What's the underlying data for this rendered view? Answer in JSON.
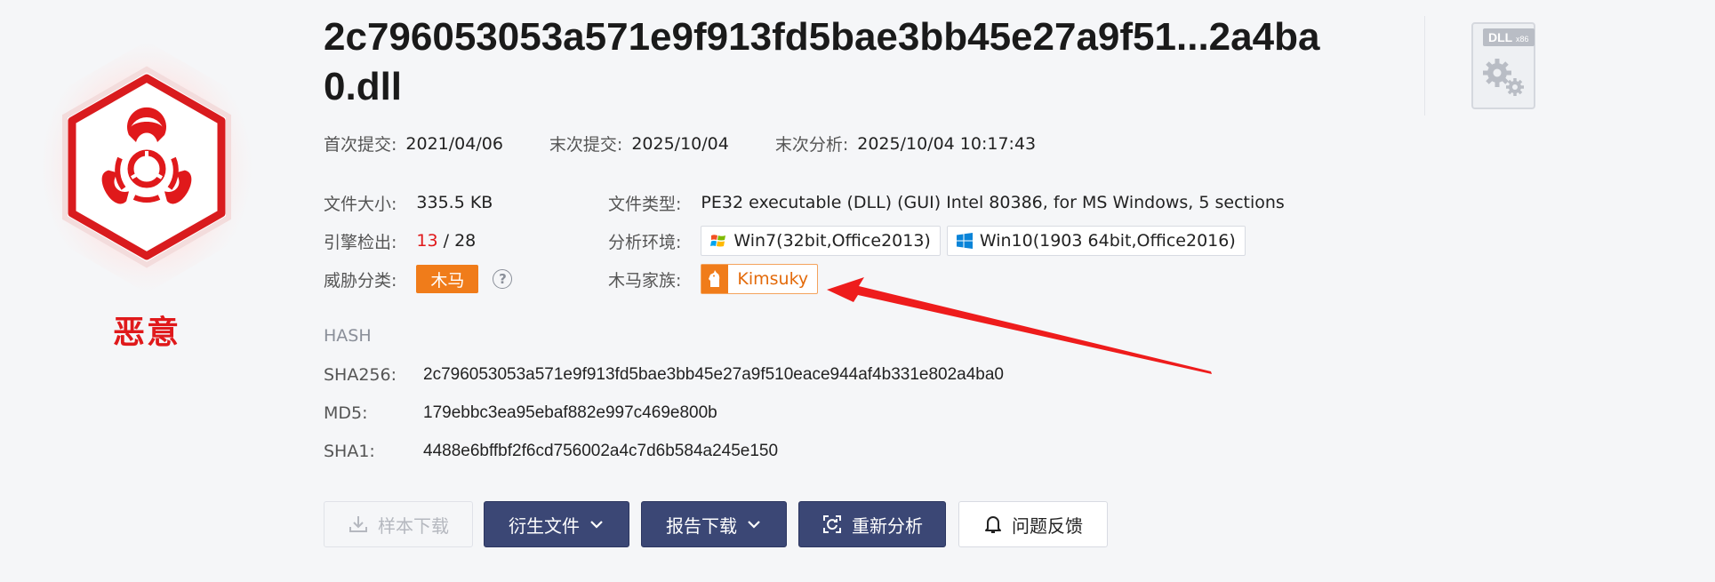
{
  "file": {
    "title": "2c796053053a571e9f913fd5bae3bb45e27a9f51...2a4ba0.dll",
    "verdict": "恶意"
  },
  "meta": {
    "first_submit_label": "首次提交:",
    "first_submit_value": "2021/04/06",
    "last_submit_label": "末次提交:",
    "last_submit_value": "2025/10/04",
    "last_analysis_label": "末次分析:",
    "last_analysis_value": "2025/10/04 10:17:43"
  },
  "details": {
    "size_label": "文件大小:",
    "size_value": "335.5 KB",
    "detect_label": "引擎检出:",
    "detect_count": "13",
    "detect_sep": " / ",
    "detect_total": "28",
    "threat_label": "威胁分类:",
    "threat_value": "木马",
    "help_glyph": "?",
    "type_label": "文件类型:",
    "type_value": "PE32 executable (DLL) (GUI) Intel 80386, for MS Windows, 5 sections",
    "env_label": "分析环境:",
    "env_items": [
      {
        "label": "Win7(32bit,Office2013)",
        "icon": "windows7-icon"
      },
      {
        "label": "Win10(1903 64bit,Office2016)",
        "icon": "windows10-icon"
      }
    ],
    "family_label": "木马家族:",
    "family_value": "Kimsuky"
  },
  "hash": {
    "section_label": "HASH",
    "sha256_label": "SHA256:",
    "sha256_value": "2c796053053a571e9f913fd5bae3bb45e27a9f510eace944af4b331e802a4ba0",
    "md5_label": "MD5:",
    "md5_value": "179ebbc3ea95ebaf882e997c469e800b",
    "sha1_label": "SHA1:",
    "sha1_value": "4488e6bffbf2f6cd756002a4c7d6b584a245e150"
  },
  "actions": {
    "download_sample": "样本下载",
    "derived_files": "衍生文件",
    "report_download": "报告下载",
    "reanalyze": "重新分析",
    "feedback": "问题反馈"
  },
  "file_icon": {
    "label": "DLL",
    "sub": "x86"
  },
  "colors": {
    "malicious_red": "#e0191b",
    "threat_orange": "#f07c1a",
    "primary_button": "#3b4775",
    "annotation_arrow": "#ee1c1c"
  }
}
